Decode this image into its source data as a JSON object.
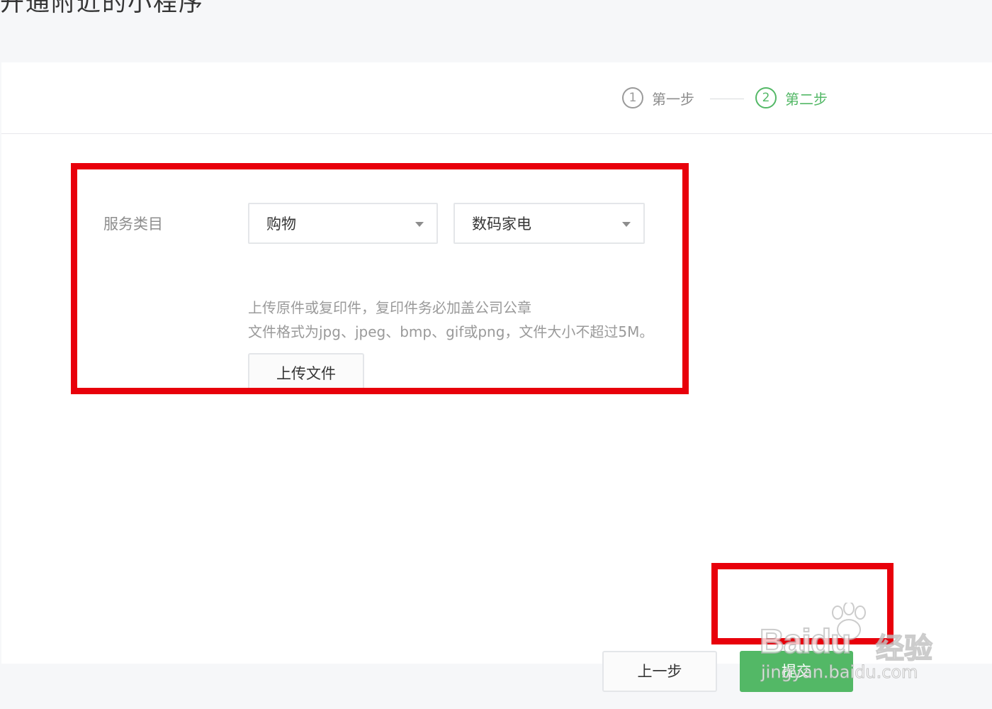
{
  "page": {
    "title": "开通附近的小程序"
  },
  "steps": [
    {
      "num": "1",
      "label": "第一步",
      "active": false
    },
    {
      "num": "2",
      "label": "第二步",
      "active": true
    }
  ],
  "form": {
    "category_label": "服务类目",
    "category_primary": "购物",
    "category_secondary": "数码家电",
    "hint_line1": "上传原件或复印件，复印件务必加盖公司公章",
    "hint_line2": "文件格式为jpg、jpeg、bmp、gif或png，文件大小不超过5M。",
    "upload_label": "上传文件"
  },
  "actions": {
    "prev_label": "上一步",
    "submit_label": "提交"
  },
  "watermark": {
    "brand": "Bai",
    "brand2": "du",
    "cn": "经验",
    "url": "jingyan.baidu.com"
  },
  "colors": {
    "accent": "#53b866",
    "highlight": "#e8000b"
  }
}
